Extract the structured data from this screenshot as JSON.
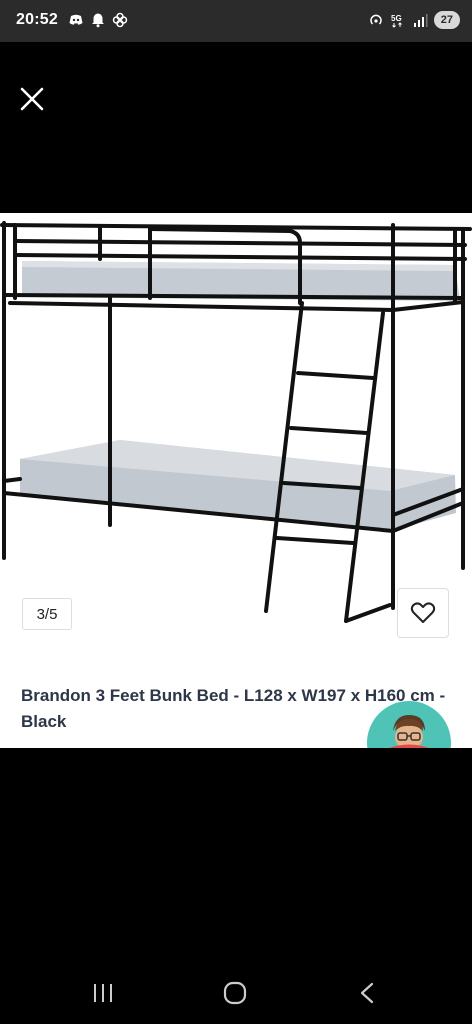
{
  "status_bar": {
    "time": "20:52",
    "left_icons": [
      "discord-icon",
      "bell-icon",
      "pinwheel-icon"
    ],
    "right_icons": [
      "hotspot-icon",
      "5g-icon",
      "signal-icon"
    ],
    "battery": "27"
  },
  "viewer": {
    "close_icon": "close-icon",
    "image_counter": "3/5",
    "favorite_icon": "heart-icon"
  },
  "product": {
    "title": "Brandon 3 Feet Bunk Bed - L128 x W197 x H160 cm - Black"
  },
  "nav_bar": {
    "icons": [
      "recent-apps-icon",
      "home-icon",
      "back-icon"
    ]
  },
  "colors": {
    "status_bar_bg": "#2b2b2b",
    "title_text": "#2d3748",
    "avatar_bg": "#4fc3b5"
  }
}
